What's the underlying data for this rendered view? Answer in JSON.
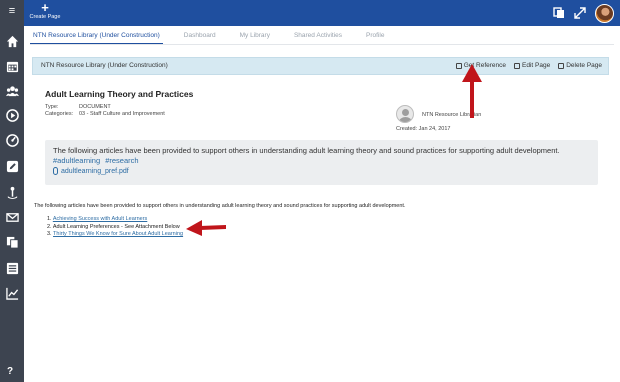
{
  "topbar": {
    "create_page_label": "Create Page"
  },
  "tabs": [
    {
      "label": "NTN Resource Library (Under Construction)",
      "active": true
    },
    {
      "label": "Dashboard",
      "active": false
    },
    {
      "label": "My Library",
      "active": false
    },
    {
      "label": "Shared Activities",
      "active": false
    },
    {
      "label": "Profile",
      "active": false
    }
  ],
  "header": {
    "title": "NTN Resource Library (Under Construction)",
    "get_reference": "Get Reference",
    "edit_page": "Edit Page",
    "delete_page": "Delete Page"
  },
  "resource": {
    "title": "Adult Learning Theory and Practices",
    "type_label": "Type:",
    "type_value": "DOCUMENT",
    "categories_label": "Categories:",
    "categories_value": "03 - Staff Culture and Improvement",
    "author": "NTN Resource Librarian",
    "created_label": "Created:",
    "created_value": "Jan 24, 2017",
    "description": "The following articles have been provided to support others in understanding adult learning theory and sound practices for supporting adult development.",
    "tags": [
      "#adultlearning",
      "#research"
    ],
    "attachment": "adultlearning_pref.pdf"
  },
  "body": {
    "intro": "The following articles have been provided to support others in understanding adult learning theory and sound practices for supporting adult development.",
    "items": [
      {
        "num": "1.",
        "text": "Achieving Success with Adult Learners",
        "link": true
      },
      {
        "num": "2.",
        "text": "Adult Learning Preferences - See Attachment Below",
        "link": false
      },
      {
        "num": "3.",
        "text": "Thirty Things We Know for Sure About Adult Learning",
        "link": true
      }
    ]
  },
  "sidebar": {
    "icons": [
      "menu-icon",
      "home-icon",
      "calendar-icon",
      "people-icon",
      "play-icon",
      "gauge-icon",
      "edit-icon",
      "anchor-icon",
      "mail-icon",
      "copy-icon",
      "list-icon",
      "chart-icon",
      "help-icon"
    ]
  },
  "colors": {
    "topbar": "#1f4f9f",
    "sidebar": "#3d4450",
    "headbar": "#d6e9f2",
    "link": "#2e6da4",
    "arrow": "#c0151b"
  }
}
